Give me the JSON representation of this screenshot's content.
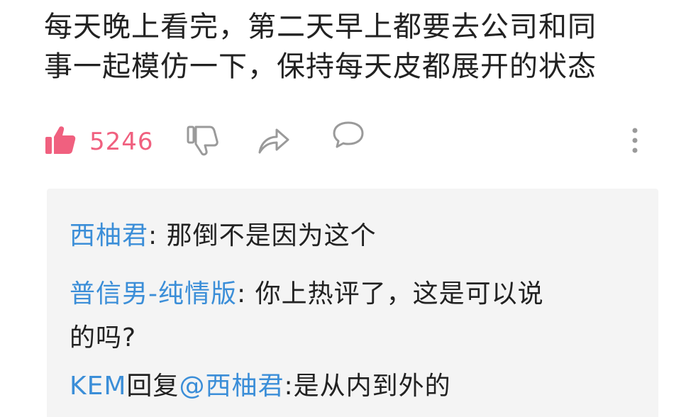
{
  "comment": {
    "line1": "每天晚上看完，第二天早上都要去公司和同",
    "line2": "事一起模仿一下，保持每天皮都展开的状态"
  },
  "actions": {
    "like_count": "5246",
    "icons": [
      "thumbs-up-icon",
      "thumbs-down-icon",
      "share-icon",
      "comment-icon",
      "more-icon"
    ],
    "like_color": "#f0607f",
    "icon_color": "#9a9a9a"
  },
  "replies": [
    {
      "user": "西柚君",
      "sep": ": ",
      "text": "那倒不是因为这个"
    },
    {
      "user": "普信男-纯情版",
      "sep": ": ",
      "text_line1": "你上热评了，这是可以说",
      "text_line2": "的吗?"
    },
    {
      "user": "KEM",
      "mid": "回复",
      "mention": "@西柚君",
      "sep": ":",
      "text": "是从内到外的"
    }
  ],
  "colors": {
    "link": "#3b8ed8",
    "reply_bg": "#f4f4f4",
    "text": "#222222"
  }
}
